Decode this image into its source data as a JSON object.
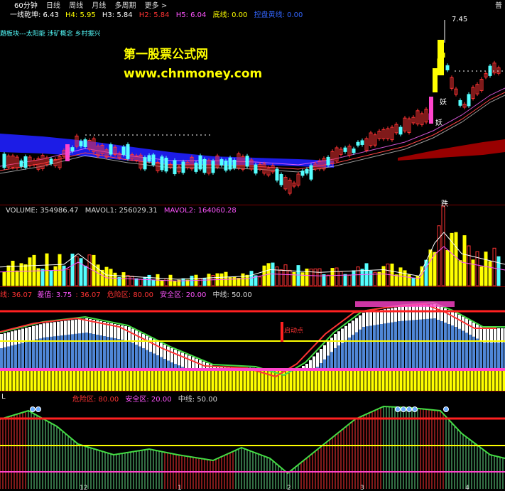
{
  "toolbar": {
    "tabs": [
      "60分钟",
      "日线",
      "周线",
      "月线",
      "多周期",
      "更多 >"
    ],
    "right_label": "普"
  },
  "indicator_row": {
    "items": [
      {
        "text": "一线乾坤: 6.43",
        "color": "#ffffff"
      },
      {
        "text": "H4: 5.95",
        "color": "#ffff00"
      },
      {
        "text": "H3: 5.84",
        "color": "#ffffff"
      },
      {
        "text": "H2: 5.84",
        "color": "#ff3333"
      },
      {
        "text": "H5: 6.04",
        "color": "#ff55ff"
      },
      {
        "text": "底线: 0.00",
        "color": "#ffff00"
      },
      {
        "text": "控盘黄线: 0.00",
        "color": "#3366ff"
      }
    ]
  },
  "concepts": "題板块---太阳能 涉矿概念 乡村振兴",
  "watermark": {
    "title": "第一股票公式网",
    "url": "www.chnmoney.com"
  },
  "price_pane": {
    "high_label": "7.45",
    "marks": {
      "yao1": "妖",
      "yao2": "妖",
      "die": "跌"
    }
  },
  "volume_pane": {
    "items": [
      {
        "text": "VOLUME: 354986.47",
        "color": "#dddddd"
      },
      {
        "text": "MAVOL1: 256029.31",
        "color": "#dddddd"
      },
      {
        "text": "MAVOL2: 164060.28",
        "color": "#ff55ff"
      }
    ]
  },
  "osc_pane": {
    "items": [
      {
        "text": "线: 36.07",
        "color": "#ff3333"
      },
      {
        "text": "差值: 3.75",
        "color": "#ff55ff"
      },
      {
        "text": ": 36.07",
        "color": "#ff3333"
      },
      {
        "text": "危险区: 80.00",
        "color": "#ff3333"
      },
      {
        "text": "安全区: 20.00",
        "color": "#ff55ff"
      },
      {
        "text": "中线: 50.00",
        "color": "#dddddd"
      }
    ],
    "start_label": "启动点"
  },
  "bottom_pane": {
    "items": [
      {
        "text": "危险区: 80.00",
        "color": "#ff3333"
      },
      {
        "text": "安全区: 20.00",
        "color": "#ff55ff"
      },
      {
        "text": "中线: 50.00",
        "color": "#dddddd"
      }
    ],
    "left_label": "L",
    "axis_labels": [
      "12",
      "1",
      "2",
      "3",
      "4"
    ]
  },
  "colors": {
    "up": "#ff3333",
    "down": "#55ffff",
    "yellow": "#ffff00",
    "magenta": "#ff44cc",
    "blue_band": "#1f1fff",
    "macd_blue": "#4f86d6",
    "danger": "#ff2020",
    "white": "#ffffff",
    "green": "#44dd44"
  }
}
